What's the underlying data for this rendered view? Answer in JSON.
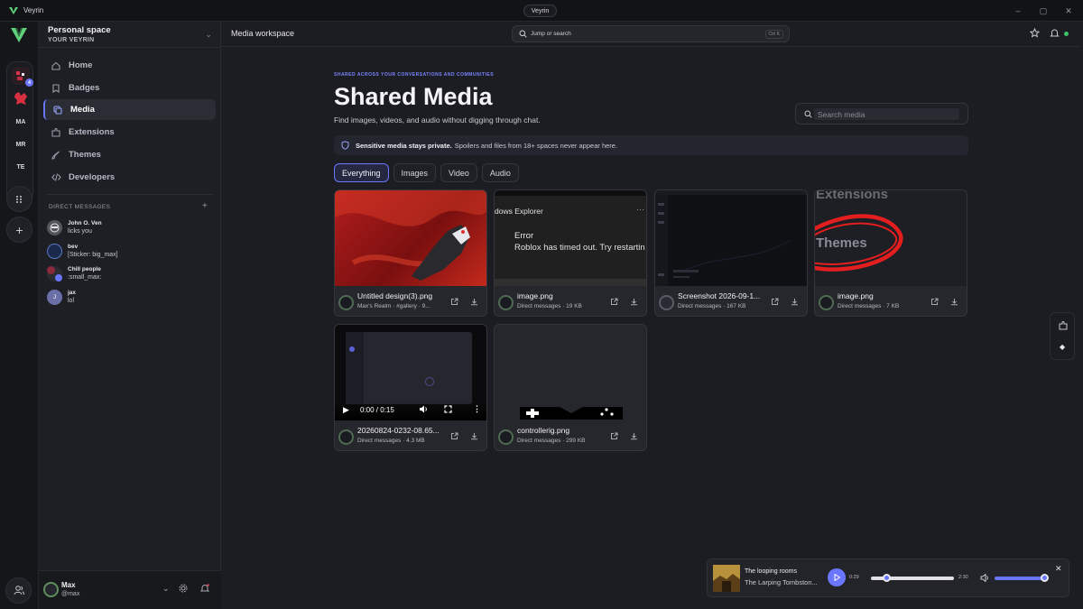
{
  "app": {
    "name": "Veyrin",
    "window_title": "Veyrin",
    "accent": "#6b76ff"
  },
  "rail": {
    "servers": [
      {
        "label": "",
        "badge": "4"
      },
      {
        "label": ""
      },
      {
        "label": "MA"
      },
      {
        "label": "MR"
      },
      {
        "label": "TE"
      }
    ]
  },
  "sidebar": {
    "space_title": "Personal space",
    "space_subtitle": "YOUR VEYRIN",
    "nav": [
      {
        "label": "Home",
        "icon": "home-icon"
      },
      {
        "label": "Badges",
        "icon": "badge-icon"
      },
      {
        "label": "Media",
        "icon": "media-icon",
        "active": true
      },
      {
        "label": "Extensions",
        "icon": "extensions-icon"
      },
      {
        "label": "Themes",
        "icon": "themes-icon"
      },
      {
        "label": "Developers",
        "icon": "code-icon"
      }
    ],
    "dm_header": "DIRECT MESSAGES",
    "dms": [
      {
        "name": "John O. Ven",
        "message": "licks you"
      },
      {
        "name": "bev",
        "message": "[Sticker: big_max]"
      },
      {
        "name": "Chill people",
        "message": ":small_max:"
      },
      {
        "name": "jax",
        "message": "lol",
        "initial": "J"
      }
    ]
  },
  "user": {
    "name": "Max",
    "handle": "@max"
  },
  "topbar": {
    "workspace": "Media workspace",
    "search_placeholder": "Jump or search",
    "shortcut": "Ctrl K"
  },
  "page": {
    "eyebrow": "SHARED ACROSS YOUR CONVERSATIONS AND COMMUNITIES",
    "title": "Shared Media",
    "subtitle": "Find images, videos, and audio without digging through chat.",
    "search_placeholder": "Search media",
    "notice_bold": "Sensitive media stays private.",
    "notice_text": "Spoilers and files from 18+ spaces never appear here.",
    "tabs": [
      "Everything",
      "Images",
      "Video",
      "Audio"
    ],
    "active_tab": "Everything"
  },
  "media": [
    {
      "name": "Untitled design(3).png",
      "source": "Max's Realm · #gallery · 9..."
    },
    {
      "name": "image.png",
      "source": "Direct messages · 19 KB",
      "thumb_text": [
        "dows Explorer",
        "Error",
        "Roblox has timed out. Try restartin"
      ]
    },
    {
      "name": "Screenshot 2026-09-1...",
      "source": "Direct messages · 167 KB"
    },
    {
      "name": "image.png",
      "source": "Direct messages · 7 KB",
      "thumb_text": [
        "Extensions",
        "Themes"
      ]
    },
    {
      "name": "20260824-0232-08.65...",
      "source": "Direct messages · 4.3 MB",
      "video_time": "0:00 / 0:15"
    },
    {
      "name": "controllerig.png",
      "source": "Direct messages · 299 KB"
    }
  ],
  "player": {
    "title": "The looping rooms",
    "artist": "The Larping Tombston...",
    "elapsed": "0:29",
    "duration": "2:30",
    "progress": 0.19,
    "volume": 0.95
  }
}
